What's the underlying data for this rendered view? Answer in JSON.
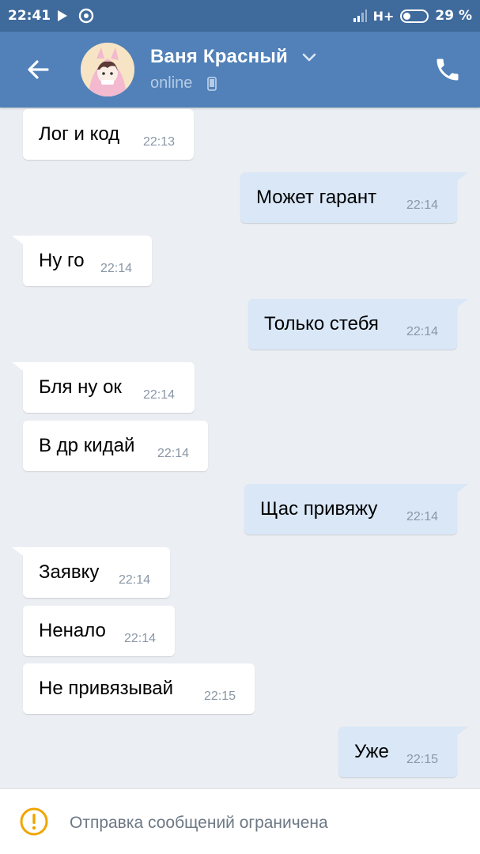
{
  "status_bar": {
    "time": "22:41",
    "network": "H+",
    "battery": "29 %"
  },
  "header": {
    "contact_name": "Ваня Красный",
    "status": "online"
  },
  "messages": [
    {
      "text": "Лог и код",
      "time": "22:13",
      "dir": "in"
    },
    {
      "text": "Может гарант",
      "time": "22:14",
      "dir": "out"
    },
    {
      "text": "Ну го",
      "time": "22:14",
      "dir": "in"
    },
    {
      "text": "Только стебя",
      "time": "22:14",
      "dir": "out"
    },
    {
      "text": "Бля ну ок",
      "time": "22:14",
      "dir": "in"
    },
    {
      "text": "В др кидай",
      "time": "22:14",
      "dir": "in"
    },
    {
      "text": "Щас привяжу",
      "time": "22:14",
      "dir": "out"
    },
    {
      "text": "Заявку",
      "time": "22:14",
      "dir": "in"
    },
    {
      "text": "Ненало",
      "time": "22:14",
      "dir": "in"
    },
    {
      "text": "Не привязывай",
      "time": "22:15",
      "dir": "in"
    },
    {
      "text": "Уже",
      "time": "22:15",
      "dir": "out"
    }
  ],
  "restriction": {
    "text": "Отправка сообщений ограничена"
  },
  "colors": {
    "header": "#5181b8",
    "status_bar": "#3f6a9c",
    "outgoing_bubble": "#d9e7f7",
    "incoming_bubble": "#ffffff",
    "warning": "#f0a500"
  },
  "icons": [
    "back-arrow-icon",
    "chevron-down-icon",
    "mobile-device-icon",
    "phone-icon",
    "warning-icon"
  ]
}
